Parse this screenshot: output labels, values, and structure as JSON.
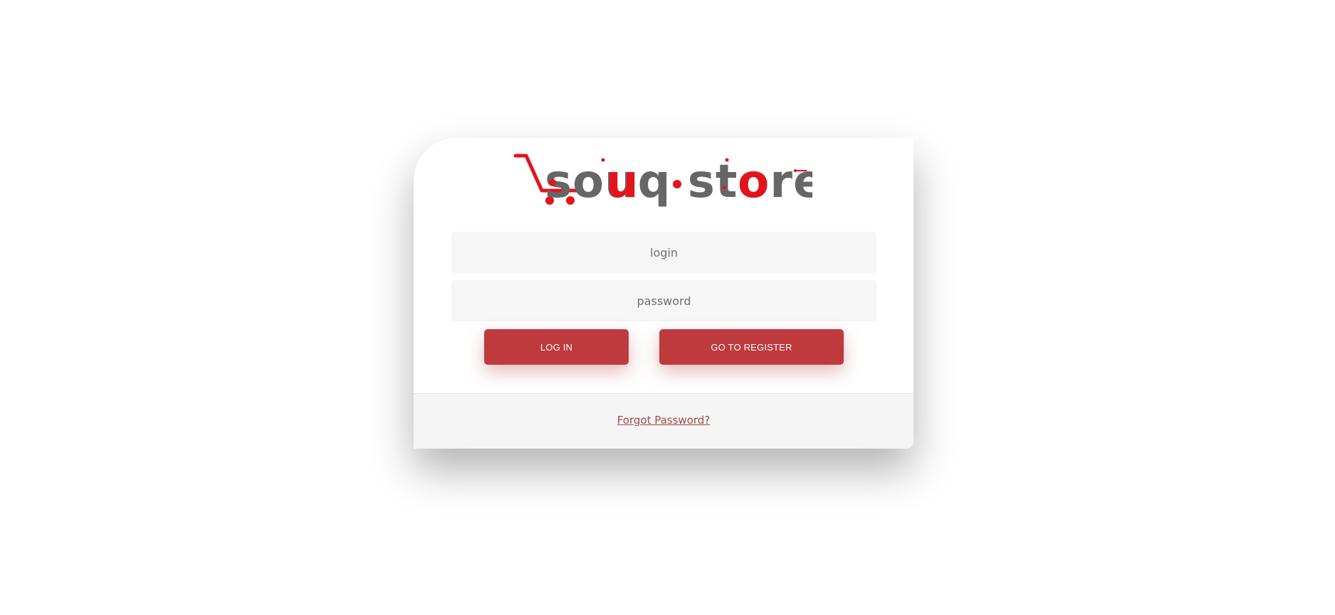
{
  "logo": {
    "text": "souq store",
    "accent_color": "#e3141b",
    "text_color": "#666666",
    "icon": "shopping-cart-icon"
  },
  "form": {
    "login_placeholder": "login",
    "password_placeholder": "password",
    "login_button_label": "LOG IN",
    "register_button_label": "GO TO REGISTER",
    "button_color": "#be3a3c"
  },
  "footer": {
    "forgot_password_label": "Forgot Password?"
  }
}
